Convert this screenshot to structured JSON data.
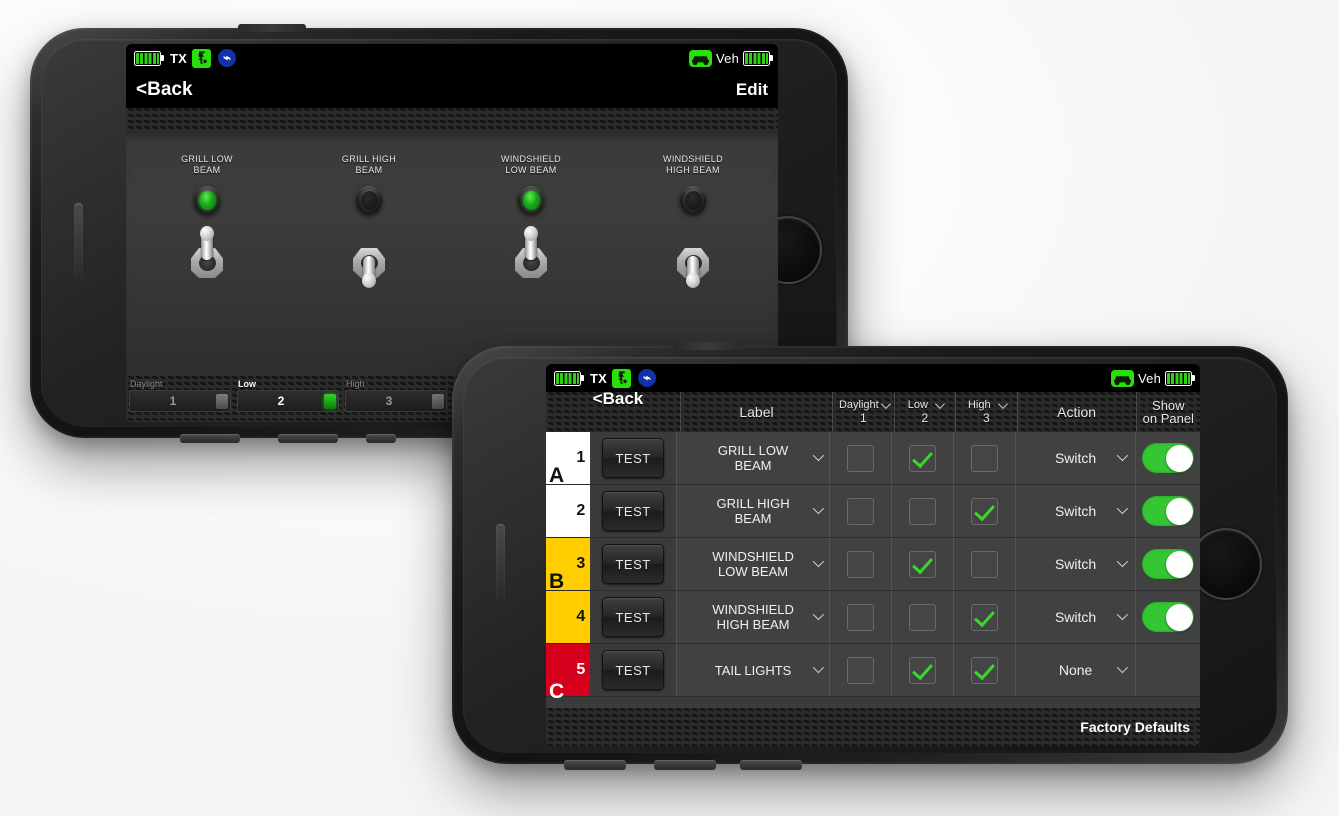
{
  "phone1": {
    "status_bar": {
      "battery_left_icon": "battery-icon",
      "tx_label": "TX",
      "remote_icon": "remote-control-icon",
      "bluetooth_icon": "bluetooth-icon",
      "vehicle_icon": "vehicle-icon",
      "veh_label": "Veh",
      "battery_right_icon": "battery-icon"
    },
    "nav": {
      "back_label": "<Back",
      "edit_label": "Edit"
    },
    "switches": [
      {
        "label": "GRILL LOW\nBEAM",
        "led_on": true,
        "toggle": "up"
      },
      {
        "label": "GRILL HIGH\nBEAM",
        "led_on": false,
        "toggle": "down"
      },
      {
        "label": "WINDSHIELD\nLOW BEAM",
        "led_on": true,
        "toggle": "up"
      },
      {
        "label": "WINDSHIELD\nHIGH BEAM",
        "led_on": false,
        "toggle": "down"
      }
    ],
    "modes": [
      {
        "name": "Daylight",
        "number": "1",
        "active": false
      },
      {
        "name": "Low",
        "number": "2",
        "active": true
      },
      {
        "name": "High",
        "number": "3",
        "active": false
      }
    ]
  },
  "phone2": {
    "status_bar": {
      "battery_left_icon": "battery-icon",
      "tx_label": "TX",
      "remote_icon": "remote-control-icon",
      "bluetooth_icon": "bluetooth-icon",
      "vehicle_icon": "vehicle-icon",
      "veh_label": "Veh",
      "battery_right_icon": "battery-icon"
    },
    "header": {
      "back_label": "<Back",
      "columns": [
        {
          "title": "Label",
          "sub": "",
          "dropdown": false
        },
        {
          "title": "Daylight",
          "sub": "1",
          "dropdown": true
        },
        {
          "title": "Low",
          "sub": "2",
          "dropdown": true
        },
        {
          "title": "High",
          "sub": "3",
          "dropdown": true
        },
        {
          "title": "Action",
          "sub": "",
          "dropdown": false
        },
        {
          "title": "Show",
          "sub": "on Panel",
          "dropdown": false
        }
      ]
    },
    "rows": [
      {
        "num": "1",
        "group": "A",
        "group_color": "#ffffff",
        "test_label": "TEST",
        "label": "GRILL LOW\nBEAM",
        "daylight": false,
        "low": true,
        "high": false,
        "action": "Switch",
        "show_on_panel": true
      },
      {
        "num": "2",
        "group": "",
        "group_color": "#ffffff",
        "test_label": "TEST",
        "label": "GRILL HIGH\nBEAM",
        "daylight": false,
        "low": false,
        "high": true,
        "action": "Switch",
        "show_on_panel": true
      },
      {
        "num": "3",
        "group": "B",
        "group_color": "#ffcd00",
        "test_label": "TEST",
        "label": "WINDSHIELD\nLOW BEAM",
        "daylight": false,
        "low": true,
        "high": false,
        "action": "Switch",
        "show_on_panel": true
      },
      {
        "num": "4",
        "group": "",
        "group_color": "#ffcd00",
        "test_label": "TEST",
        "label": "WINDSHIELD\nHIGH BEAM",
        "daylight": false,
        "low": false,
        "high": true,
        "action": "Switch",
        "show_on_panel": true
      },
      {
        "num": "5",
        "group": "C",
        "group_color": "#d6001c",
        "test_label": "TEST",
        "label": "TAIL LIGHTS",
        "daylight": false,
        "low": true,
        "high": true,
        "action": "None",
        "show_on_panel": false
      }
    ],
    "footer": {
      "factory_defaults_label": "Factory Defaults"
    }
  },
  "colors": {
    "accent_green": "#34c633",
    "check_green": "#3ad72e",
    "group_a": "#ffffff",
    "group_b": "#ffcd00",
    "group_c": "#d6001c",
    "bluetooth_blue": "#1432a8",
    "panel_gray": "#3b3b3b"
  }
}
